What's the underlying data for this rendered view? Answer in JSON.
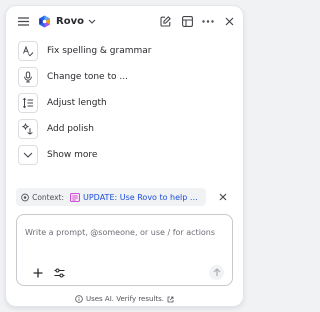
{
  "header": {
    "menu_icon": "hamburger-icon",
    "brand_name": "Rovo",
    "brand_logo": "rovo-logo-icon",
    "actions": [
      "edit-icon",
      "sidebar-panel-icon",
      "more-horizontal-icon",
      "close-icon"
    ]
  },
  "menu": {
    "items": [
      {
        "label": "Fix spelling & grammar",
        "icon": "spellcheck-icon"
      },
      {
        "label": "Change tone to ...",
        "icon": "microphone-icon"
      },
      {
        "label": "Adjust length",
        "icon": "text-length-icon"
      },
      {
        "label": "Add polish",
        "icon": "sparkle-icon"
      },
      {
        "label": "Show more",
        "icon": "chevron-down-icon"
      }
    ]
  },
  "context": {
    "label": "Context:",
    "page_title": "UPDATE: Use Rovo to help write..."
  },
  "prompt": {
    "placeholder": "Write a prompt, @someone, or use / for actions",
    "value": ""
  },
  "footer": {
    "text": "Uses AI. Verify results."
  },
  "colors": {
    "accent": "#1d4ed8",
    "background": "#f1f2f4",
    "panel": "#ffffff"
  }
}
